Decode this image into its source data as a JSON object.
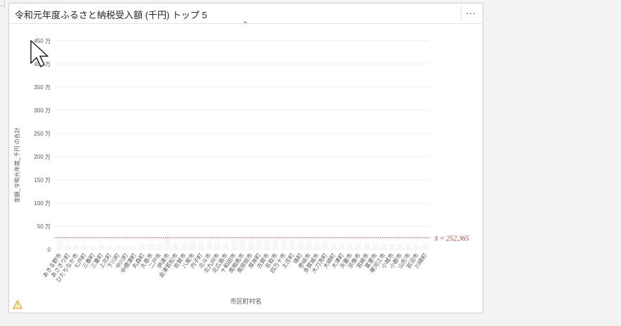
{
  "card": {
    "title": "令和元年度ふるさと納税受入額 (千円) トップ 5",
    "more_label": "···",
    "collapse_label": "⌃",
    "warning_icon": "warning-icon"
  },
  "chart_data": {
    "type": "bar",
    "title": "令和元年度ふるさと納税受入額 (千円) トップ 5",
    "xlabel": "市区町村名",
    "ylabel": "金額_令和元年度_千円 の合計",
    "ylim": [
      0,
      4500000
    ],
    "yticks": [
      0,
      500000,
      1000000,
      1500000,
      2000000,
      2500000,
      3000000,
      3500000,
      4000000,
      4500000
    ],
    "ytick_labels": [
      "0",
      "50 万",
      "100 万",
      "150 万",
      "200 万",
      "250 万",
      "300 万",
      "350 万",
      "400 万",
      "450 万"
    ],
    "grid": true,
    "mean_line": {
      "value": 252365,
      "label": "x̄ = 252,365",
      "color": "#c0392b"
    },
    "bar_color": "#f7f7f7",
    "categories": [
      "あきる野市",
      "あさぎり町",
      "ひたちなか市",
      "七戸町",
      "三春町",
      "三重町",
      "上北町",
      "下川町",
      "中川町",
      "中標津町",
      "丸森町",
      "久慈市",
      "二戸市",
      "伊達市",
      "会津若松市",
      "佐賀市",
      "八尾市",
      "内子町",
      "北斗市",
      "北九州市",
      "北広島市",
      "十和田市",
      "南相馬市",
      "南房総市",
      "厚岸町",
      "古賀市",
      "名取市",
      "四万十市",
      "土庄町",
      "境町",
      "壱岐市",
      "多賀城市",
      "大刀洗町",
      "大崎町",
      "大津町",
      "天童市",
      "宗像市",
      "宮崎市",
      "富里市",
      "寒河江市",
      "小城市",
      "小郡市",
      "山形市",
      "岩沼市",
      "川崎町"
    ],
    "values": [
      180000,
      100000,
      100000,
      100000,
      90000,
      90000,
      80000,
      80000,
      80000,
      80000,
      120000,
      120000,
      120000,
      400000,
      140000,
      150000,
      160000,
      160000,
      150000,
      150000,
      150000,
      180000,
      220000,
      160000,
      170000,
      180000,
      190000,
      170000,
      180000,
      160000,
      160000,
      150000,
      150000,
      140000,
      140000,
      140000,
      130000,
      140000,
      130000,
      130000,
      120000,
      120000,
      120000,
      110000,
      110000
    ]
  }
}
